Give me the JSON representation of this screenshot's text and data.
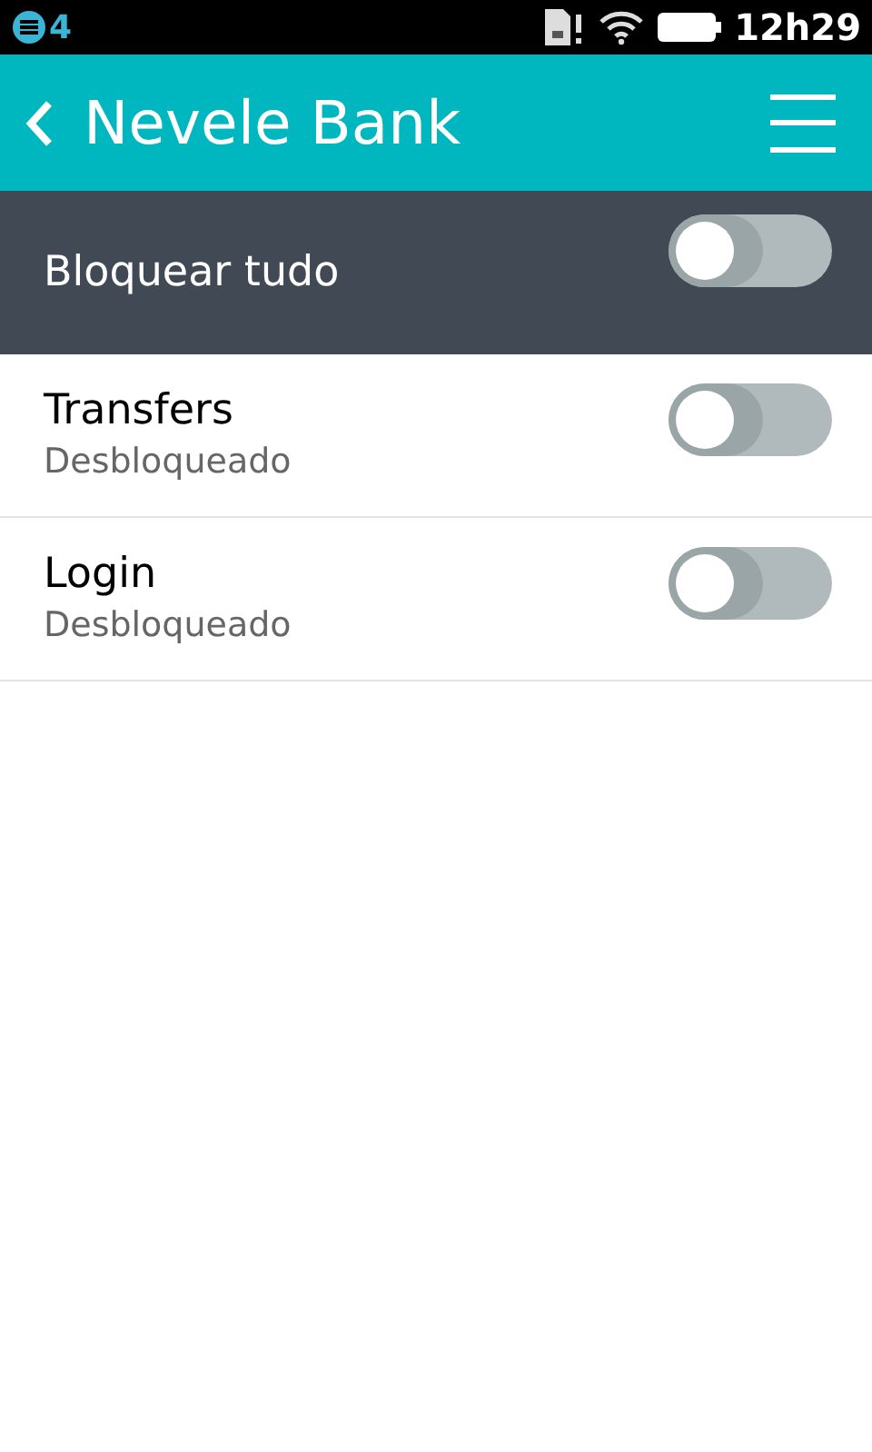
{
  "status_bar": {
    "notification_count": "4",
    "time": "12h29"
  },
  "header": {
    "title": "Nevele Bank"
  },
  "master": {
    "label": "Bloquear tudo",
    "on": false
  },
  "items": [
    {
      "title": "Transfers",
      "status": "Desbloqueado",
      "on": false
    },
    {
      "title": "Login",
      "status": "Desbloqueado",
      "on": false
    }
  ]
}
